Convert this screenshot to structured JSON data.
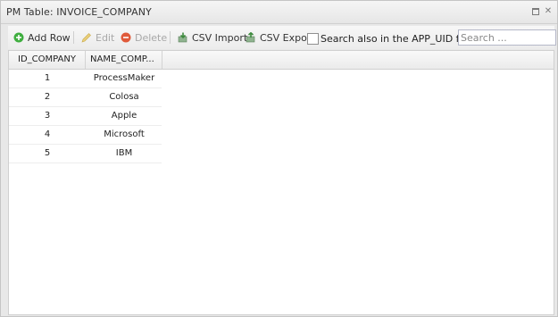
{
  "window": {
    "title": "PM Table: INVOICE_COMPANY"
  },
  "toolbar": {
    "add_row": "Add Row",
    "edit": "Edit",
    "delete": "Delete",
    "csv_import": "CSV Import",
    "csv_export": "CSV Export",
    "search_label": "Search also in the APP_UID field",
    "search_placeholder": "Search ..."
  },
  "grid": {
    "columns": [
      "ID_COMPANY",
      "NAME_COMP..."
    ],
    "rows": [
      {
        "id": "1",
        "name": "ProcessMaker"
      },
      {
        "id": "2",
        "name": "Colosa"
      },
      {
        "id": "3",
        "name": "Apple"
      },
      {
        "id": "4",
        "name": "Microsoft"
      },
      {
        "id": "5",
        "name": "IBM"
      }
    ]
  },
  "colors": {
    "add_icon": "#3fae3f",
    "delete_icon": "#e05a3a",
    "csv_icon": "#3d8a3d"
  }
}
